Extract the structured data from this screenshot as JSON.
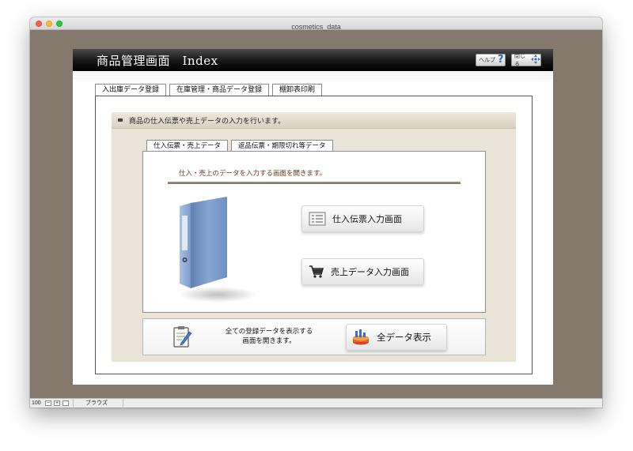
{
  "window": {
    "title": "cosmetics_data"
  },
  "header": {
    "title": "商品管理画面　Index",
    "help_label": "ヘルプ",
    "help_glyph": "?",
    "close_label": "閉じる"
  },
  "main_tabs": [
    {
      "label": "入出庫データ登録",
      "active": true
    },
    {
      "label": "在庫管理・商品データ登録",
      "active": false
    },
    {
      "label": "棚卸表印刷",
      "active": false
    }
  ],
  "info_bar": {
    "text": "商品の仕入伝票や売上データの入力を行います。"
  },
  "sub_tabs": [
    {
      "label": "仕入伝票・売上データ",
      "active": true
    },
    {
      "label": "返品伝票・期限切れ等データ",
      "active": false
    }
  ],
  "sub_panel": {
    "description": "仕入・売上のデータを入力する画面を開きます。",
    "buttons": {
      "shiire": "仕入伝票入力画面",
      "uriage": "売上データ入力画面"
    }
  },
  "bottom_panel": {
    "description_line1": "全ての登録データを表示する",
    "description_line2": "画面を開きます。",
    "all_button": "全データ表示"
  },
  "statusbar": {
    "zoom": "100",
    "mode": "ブラウズ"
  },
  "colors": {
    "window_bg": "#85796e",
    "header_bar": "#000000",
    "beige_area": "#e9e3d8",
    "binder_blue": "#7f9fcc"
  }
}
